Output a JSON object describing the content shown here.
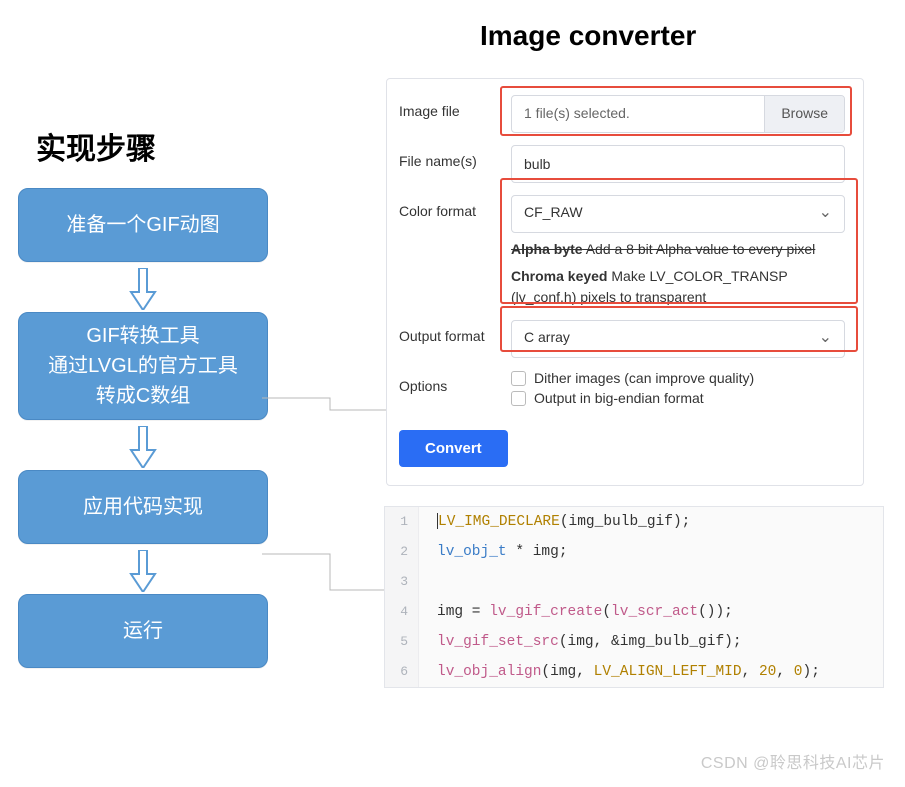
{
  "title": "Image converter",
  "steps_title": "实现步骤",
  "flow": {
    "step1": "准备一个GIF动图",
    "step2_l1": "GIF转换工具",
    "step2_l2": "通过LVGL的官方工具",
    "step2_l3": "转成C数组",
    "step3": "应用代码实现",
    "step4": "运行"
  },
  "form": {
    "image_file_label": "Image file",
    "file_selected_text": "1 file(s) selected.",
    "browse_label": "Browse",
    "file_names_label": "File name(s)",
    "file_name_value": "bulb",
    "color_format_label": "Color format",
    "color_format_value": "CF_RAW",
    "help_alpha_bold": "Alpha byte",
    "help_alpha_text": " Add a 8 bit Alpha value to every pixel",
    "help_chroma_bold": "Chroma keyed",
    "help_chroma_text": " Make LV_COLOR_TRANSP (lv_conf.h) pixels to transparent",
    "output_format_label": "Output format",
    "output_format_value": "C array",
    "options_label": "Options",
    "opt_dither": "Dither images (can improve quality)",
    "opt_bigendian": "Output in big-endian format",
    "convert_label": "Convert"
  },
  "code": {
    "lines": [
      {
        "n": "1",
        "html": "<span class='cursor-bar'></span><span class='tok-macro'>LV_IMG_DECLARE</span>(img_bulb_gif);"
      },
      {
        "n": "2",
        "html": "<span class='tok-type'>lv_obj_t</span> * img;"
      },
      {
        "n": "3",
        "html": ""
      },
      {
        "n": "4",
        "html": "img = <span class='tok-func'>lv_gif_create</span>(<span class='tok-func'>lv_scr_act</span>());"
      },
      {
        "n": "5",
        "html": "<span class='tok-func'>lv_gif_set_src</span>(img, &amp;img_bulb_gif);"
      },
      {
        "n": "6",
        "html": "<span class='tok-func'>lv_obj_align</span>(img, <span class='tok-const'>LV_ALIGN_LEFT_MID</span>, <span class='tok-num'>20</span>, <span class='tok-num'>0</span>);"
      }
    ]
  },
  "watermark": "CSDN @聆思科技AI芯片",
  "colors": {
    "box": "#5a9bd5",
    "highlight": "#e74c3c",
    "primary_btn": "#2a6df4"
  }
}
